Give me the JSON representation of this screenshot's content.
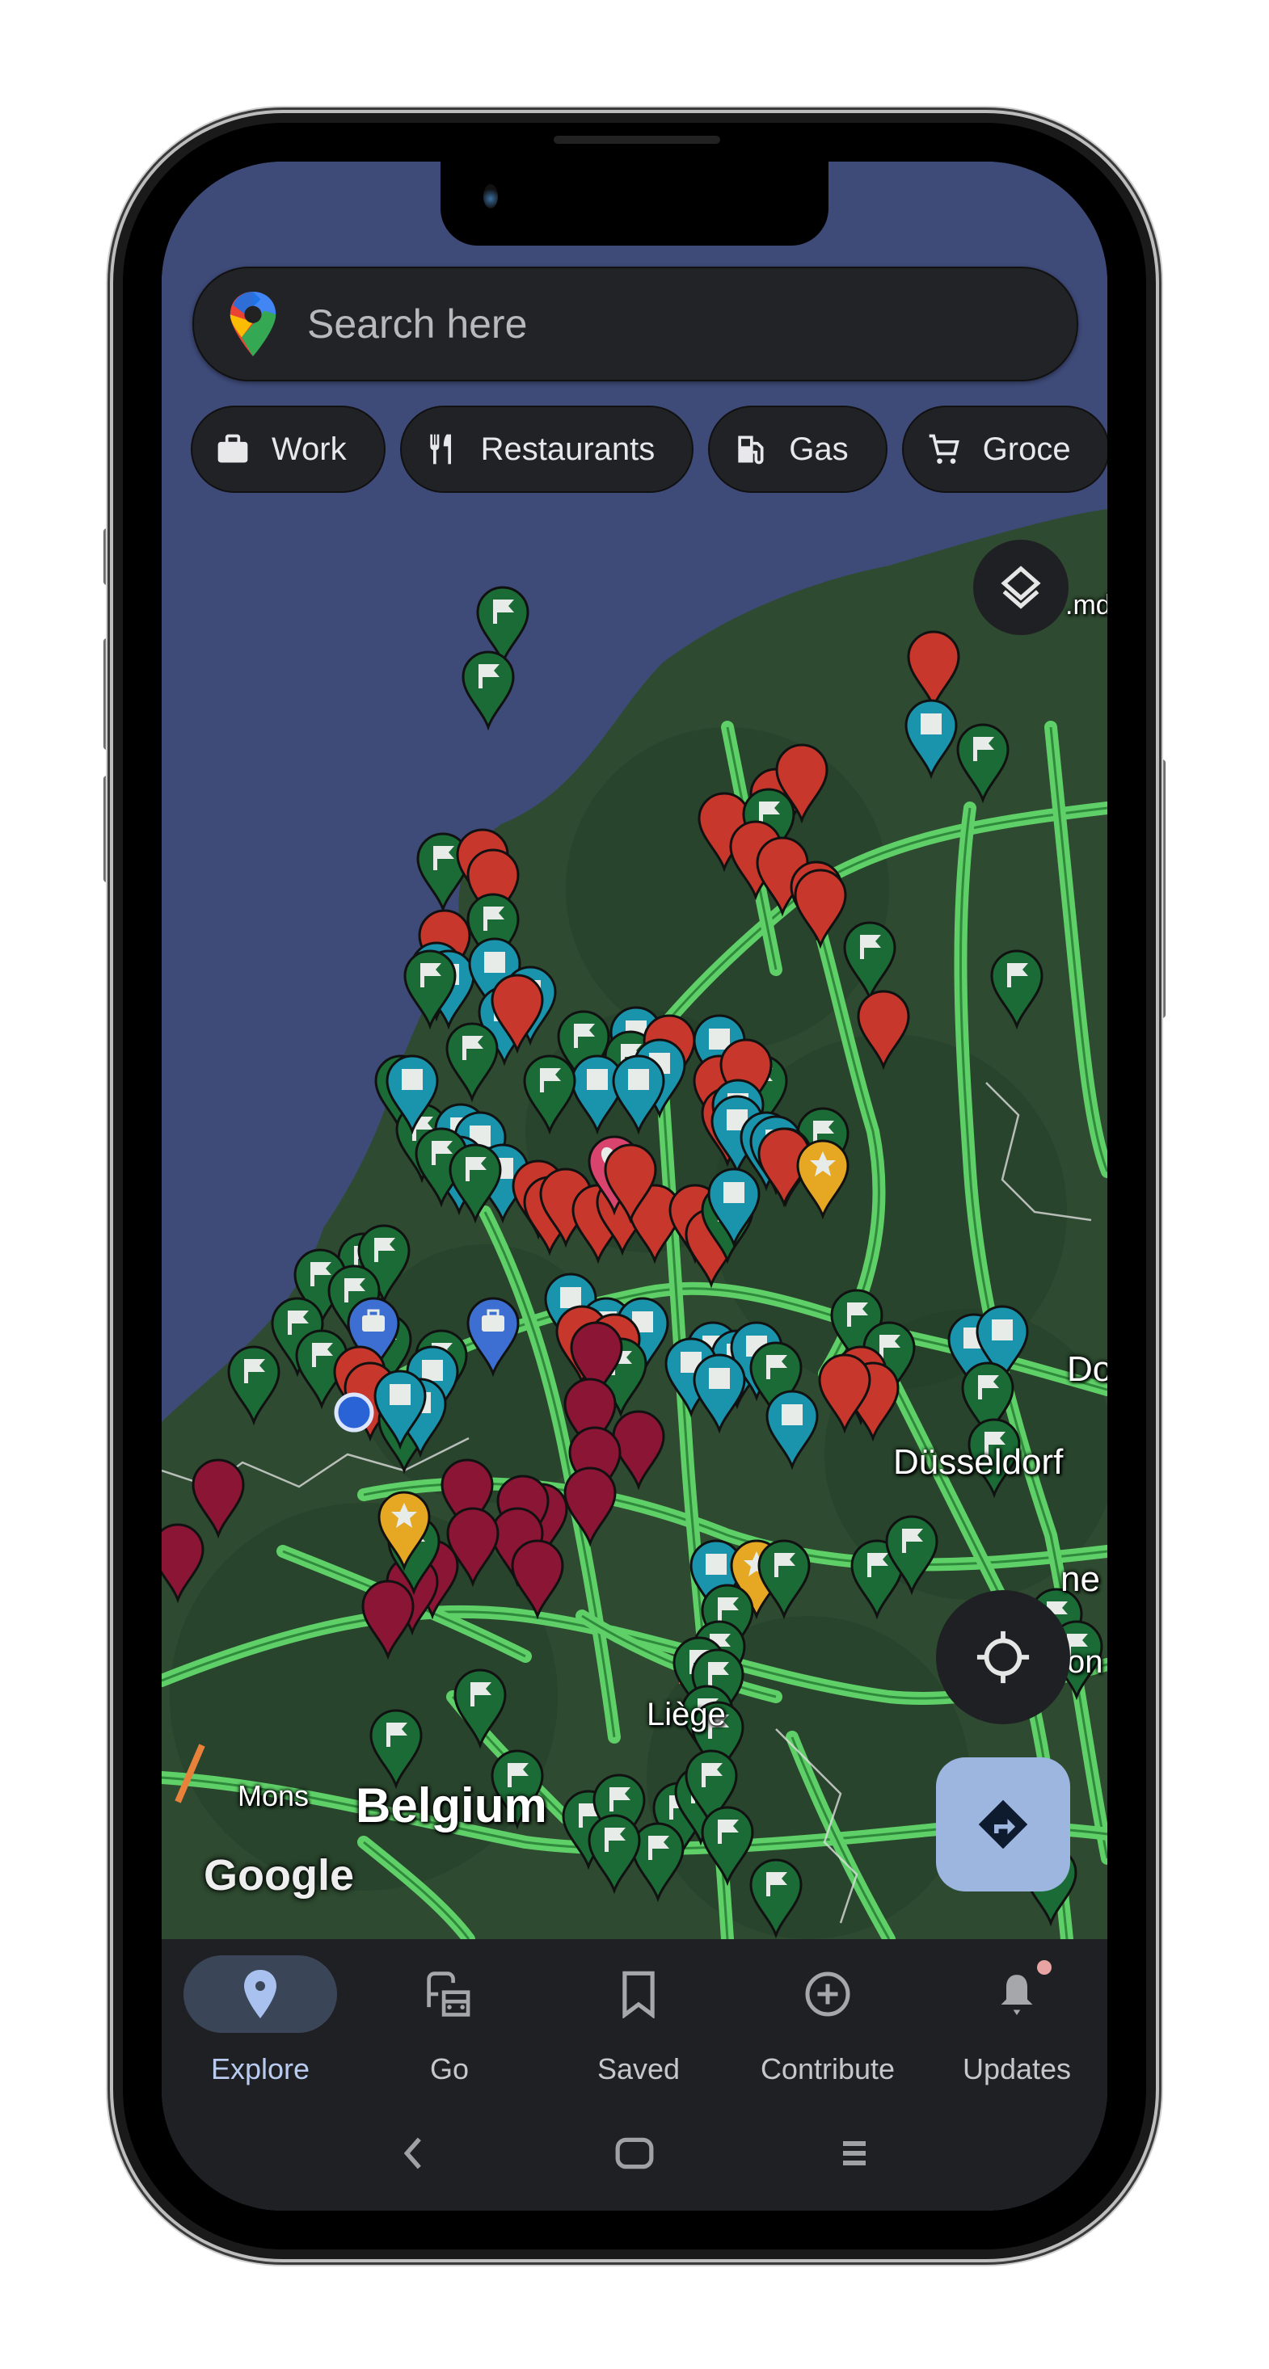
{
  "app": "Google Maps",
  "search": {
    "placeholder": "Search here",
    "logo_icon": "google-maps-pin-logo"
  },
  "chips": [
    {
      "label": "Work",
      "icon": "briefcase-icon"
    },
    {
      "label": "Restaurants",
      "icon": "fork-knife-icon"
    },
    {
      "label": "Gas",
      "icon": "gas-pump-icon"
    },
    {
      "label": "Groce",
      "icon": "shopping-cart-icon"
    }
  ],
  "map": {
    "labels": {
      "dusseldorf": "Düsseldorf",
      "belgium": "Belgium",
      "mons": "Mons",
      "liege": "Liège",
      "do": "Do",
      "ne": "ne",
      "md": ".md",
      "bo": "on"
    },
    "watermark": "Google",
    "marker_types": {
      "flag": {
        "color": "#1a6b35",
        "glyph": "flag"
      },
      "saved": {
        "color": "#1a93ad",
        "glyph": "square"
      },
      "want": {
        "color": "#c8372c",
        "glyph": "none"
      },
      "starred": {
        "color": "#e6a823",
        "glyph": "star"
      },
      "favorite": {
        "color": "#d9446e",
        "glyph": "heart"
      },
      "maroon": {
        "color": "#8b1535",
        "glyph": "none"
      },
      "work": {
        "color": "#3c6fd1",
        "glyph": "briefcase"
      },
      "home": {
        "color": "#3c6fd1",
        "glyph": "home"
      }
    },
    "colors": {
      "water": "#3e4a78",
      "land": "#2e4a30",
      "road": "#5fd068",
      "road_core": "#2f8a3c",
      "traffic_orange": "#e8813a",
      "my_location": "#2a63d6"
    }
  },
  "controls": {
    "layers_icon": "layers-icon",
    "my_location_icon": "crosshair-icon",
    "directions_icon": "directions-diamond-icon"
  },
  "bottom_nav": [
    {
      "label": "Explore",
      "icon": "location-pin-icon",
      "active": true
    },
    {
      "label": "Go",
      "icon": "commute-icon",
      "active": false
    },
    {
      "label": "Saved",
      "icon": "bookmark-icon",
      "active": false
    },
    {
      "label": "Contribute",
      "icon": "add-circle-icon",
      "active": false
    },
    {
      "label": "Updates",
      "icon": "bell-icon",
      "active": false,
      "badge": true
    }
  ],
  "system_nav": [
    "back",
    "home",
    "recents"
  ]
}
